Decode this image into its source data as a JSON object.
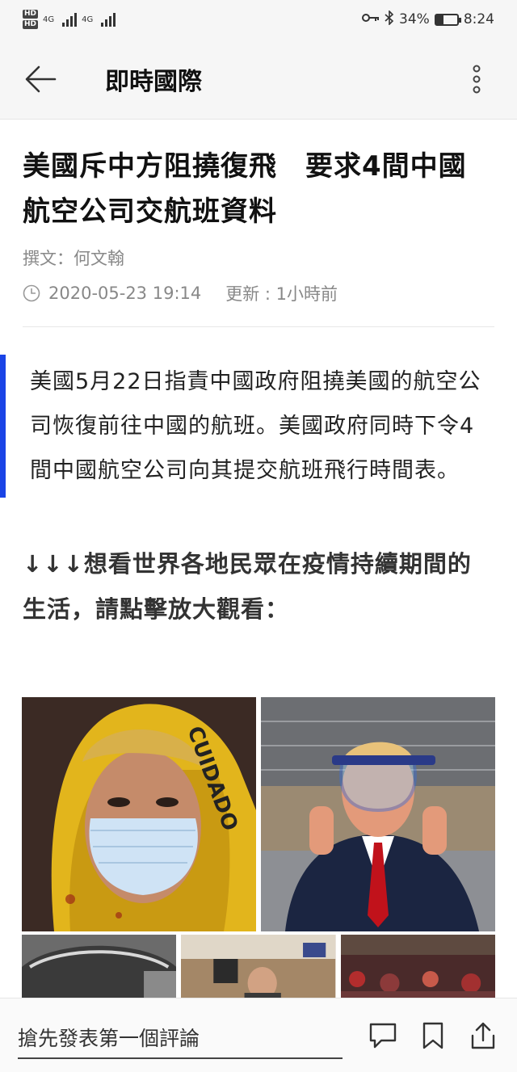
{
  "status_bar": {
    "hd1": "HD",
    "hd2": "HD",
    "network1": "4G",
    "network2": "4G",
    "battery_pct_text": "34%",
    "battery_level": 0.34,
    "time": "8:24"
  },
  "app_bar": {
    "title": "即時國際",
    "back_icon": "arrow-left-icon",
    "more_icon": "more-vertical-icon"
  },
  "article": {
    "headline": "美國斥中方阻撓復飛　要求4間中國航空公司交航班資料",
    "author": "撰文：何文翰",
    "date": "2020-05-23 19:14",
    "updated": "更新 : 1小時前",
    "summary": "美國5月22日指責中國政府阻撓美國的航空公司恢復前往中國的航班。美國政府同時下令4間中國航空公司向其提交航班飛行時間表。",
    "gallery_cta": "↓↓↓想看世界各地民眾在疫情持續期間的生活，請點擊放大觀看：",
    "accent_color": "#1a44e6"
  },
  "gallery": {
    "photo1_tape_text": "CUIDADO"
  },
  "bottom_bar": {
    "comment_placeholder": "搶先發表第一個評論",
    "icons": [
      "comment-icon",
      "bookmark-icon",
      "share-icon"
    ]
  }
}
